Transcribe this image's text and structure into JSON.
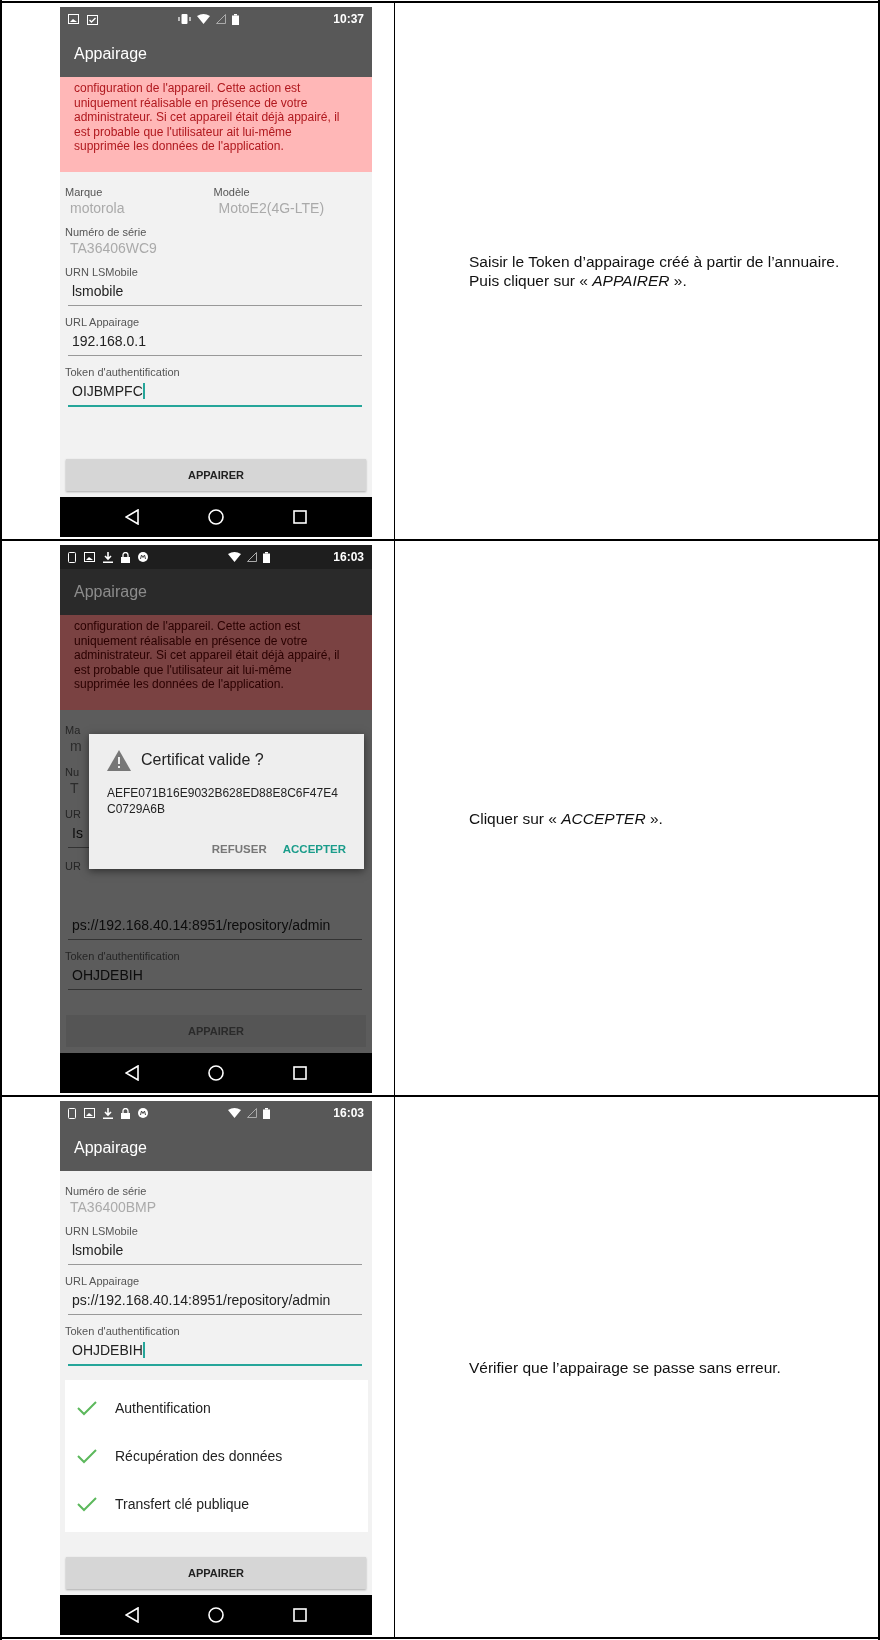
{
  "rows": [
    {
      "screen": {
        "status_bar": {
          "time": "10:37"
        },
        "app_bar": {
          "title": "Appairage"
        },
        "dimmed": false,
        "message": "configuration de l'appareil. Cette action est uniquement réalisable en présence de votre administrateur. Si cet appareil était déjà appairé, il est probable que l'utilisateur ait lui-même supprimée les données de l'application.",
        "fields": [
          {
            "kind": "pair",
            "items": [
              {
                "label": "Marque",
                "value": "motorola"
              },
              {
                "label": "Modèle",
                "value": "MotoE2(4G-LTE)"
              }
            ]
          },
          {
            "kind": "readonly",
            "label": "Numéro de série",
            "value": "TA36406WC9"
          },
          {
            "kind": "input",
            "label": "URN LSMobile",
            "value": "lsmobile",
            "focused": false
          },
          {
            "kind": "input",
            "label": "URL Appairage",
            "value": "192.168.0.1",
            "focused": false
          },
          {
            "kind": "input",
            "label": "Token d'authentification",
            "value": "OIJBMPFC",
            "focused": true
          }
        ],
        "button": {
          "label": "APPAIRER"
        }
      },
      "instruction": [
        "Saisir le Token d’appairage créé à partir de l’annuaire.",
        "Puis cliquer sur « *APPAIRER* »."
      ]
    },
    {
      "screen": {
        "status_bar": {
          "time": "16:03"
        },
        "app_bar": {
          "title": "Appairage"
        },
        "dimmed": true,
        "message": "configuration de l'appareil. Cette action est uniquement réalisable en présence de votre administrateur. Si cet appareil était déjà appairé, il est probable que l'utilisateur ait lui-même supprimée les données de l'application.",
        "covered_fields": [
          {
            "kind": "readonly",
            "label": "Ma",
            "value": "m"
          },
          {
            "kind": "readonly",
            "label": "Nu",
            "value": "T"
          },
          {
            "kind": "input",
            "label": "UR",
            "value": "Is",
            "focused": false
          },
          {
            "kind": "label",
            "label": "UR"
          }
        ],
        "fields": [
          {
            "kind": "value",
            "value": "ps://192.168.40.14:8951/repository/admin",
            "focused": false
          },
          {
            "kind": "input",
            "label": "Token d'authentification",
            "value": "OHJDEBIH",
            "focused": false
          }
        ],
        "dialog": {
          "title": "Certificat valide ?",
          "body": "AEFE071B16E9032B628ED88E8C6F47E4C0729A6B",
          "buttons": [
            {
              "label": "REFUSER",
              "primary": false
            },
            {
              "label": "ACCEPTER",
              "primary": true
            }
          ]
        },
        "button": {
          "label": "APPAIRER"
        }
      },
      "instruction": [
        "Cliquer sur « *ACCEPTER* »."
      ]
    },
    {
      "screen": {
        "status_bar": {
          "time": "16:03"
        },
        "app_bar": {
          "title": "Appairage"
        },
        "dimmed": false,
        "fields": [
          {
            "kind": "readonly",
            "label": "Numéro de série",
            "value": "TA36400BMP"
          },
          {
            "kind": "input",
            "label": "URN LSMobile",
            "value": "lsmobile",
            "focused": false
          },
          {
            "kind": "input",
            "label": "URL Appairage",
            "value": "ps://192.168.40.14:8951/repository/admin",
            "focused": false
          },
          {
            "kind": "input",
            "label": "Token d'authentification",
            "value": "OHJDEBIH",
            "focused": true
          }
        ],
        "steps": [
          {
            "label": "Authentification",
            "done": true
          },
          {
            "label": "Récupération des données",
            "done": true
          },
          {
            "label": "Transfert clé publique",
            "done": true
          }
        ],
        "button": {
          "label": "APPAIRER"
        }
      },
      "instruction": [
        "Vérifier que l’appairage se passe sans erreur."
      ]
    }
  ]
}
